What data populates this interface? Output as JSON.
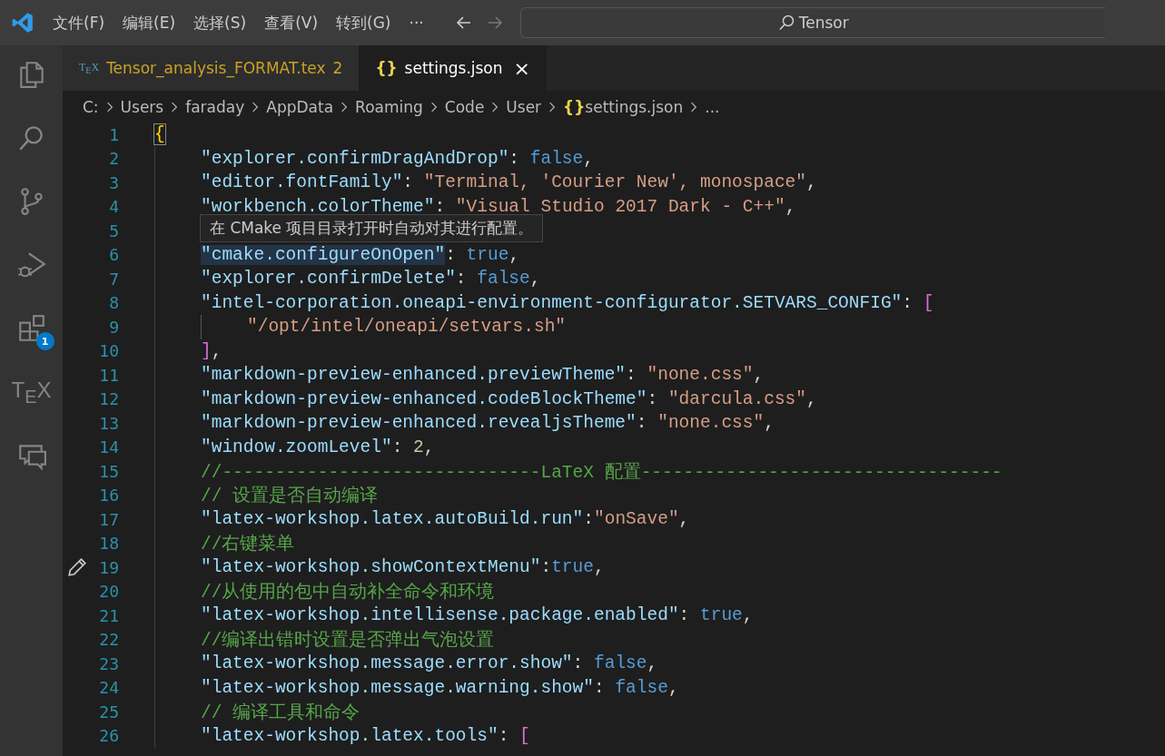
{
  "menu_bar": {
    "items": [
      "文件(F)",
      "编辑(E)",
      "选择(S)",
      "查看(V)",
      "转到(G)",
      "···"
    ],
    "search": {
      "value": "Tensor"
    }
  },
  "activity_bar": {
    "items": [
      {
        "kind": "files",
        "selected": false
      },
      {
        "kind": "search",
        "selected": false
      },
      {
        "kind": "source-control",
        "selected": false
      },
      {
        "kind": "run-debug",
        "selected": false
      },
      {
        "kind": "extensions",
        "selected": false,
        "badge": "1"
      },
      {
        "kind": "tex",
        "selected": false,
        "label": "T$_{E}$X"
      },
      {
        "kind": "remote",
        "selected": false
      }
    ]
  },
  "tabs": [
    {
      "icon": "T$_{E}$X",
      "kind": "tex",
      "label": "Tensor_analysis_FORMAT.tex",
      "problems": "2",
      "selected": false
    },
    {
      "icon": "{}",
      "kind": "json",
      "label": "settings.json",
      "selected": true,
      "close": "×"
    }
  ],
  "breadcrumb": [
    {
      "label": "C:"
    },
    {
      "label": "Users"
    },
    {
      "label": "faraday"
    },
    {
      "label": "AppData"
    },
    {
      "label": "Roaming"
    },
    {
      "label": "Code"
    },
    {
      "label": "User"
    },
    {
      "label": "settings.json",
      "icon": "{}"
    },
    {
      "label": "..."
    }
  ],
  "code": {
    "lines": [
      {
        "number": "1",
        "edit_marker": false,
        "tokens": [
          {
            "kind": "bracket_match",
            "text": "{"
          }
        ],
        "children": [
          {
            "number": "2",
            "edit_marker": false,
            "tokens": [
              {
                "kind": "key",
                "text": "\"explorer.confirmDragAndDrop\""
              },
              {
                "kind": "punct",
                "text": ": "
              },
              {
                "kind": "bool",
                "text": "false"
              },
              {
                "kind": "punct",
                "text": ","
              }
            ]
          },
          {
            "number": "3",
            "edit_marker": false,
            "tokens": [
              {
                "kind": "key",
                "text": "\"editor.fontFamily\""
              },
              {
                "kind": "punct",
                "text": ": "
              },
              {
                "kind": "str",
                "text": "\"Terminal, 'Courier New', monospace\""
              },
              {
                "kind": "punct",
                "text": ","
              }
            ]
          },
          {
            "number": "4",
            "edit_marker": false,
            "tokens": [
              {
                "kind": "key",
                "text": "\"workbench.colorTheme\""
              },
              {
                "kind": "punct",
                "text": ": "
              },
              {
                "kind": "str",
                "text": "\"Visual Studio 2017 Dark - C++\""
              },
              {
                "kind": "punct",
                "text": ","
              }
            ]
          },
          {
            "number": "5",
            "edit_marker": false
          },
          {
            "number": "6",
            "edit_marker": false,
            "tokens": [
              {
                "kind": "key",
                "text": "\"cmake.configureOnOpen\"",
                "highlighted": true
              },
              {
                "kind": "punct",
                "text": ": "
              },
              {
                "kind": "bool",
                "text": "true"
              },
              {
                "kind": "punct",
                "text": ","
              }
            ]
          },
          {
            "number": "7",
            "edit_marker": false,
            "tokens": [
              {
                "kind": "key",
                "text": "\"explorer.confirmDelete\""
              },
              {
                "kind": "punct",
                "text": ": "
              },
              {
                "kind": "bool",
                "text": "false"
              },
              {
                "kind": "punct",
                "text": ","
              }
            ]
          },
          {
            "number": "8",
            "edit_marker": false,
            "tokens": [
              {
                "kind": "key",
                "text": "\"intel-corporation.oneapi-environment-configurator.SETVARS_CONFIG\""
              },
              {
                "kind": "punct",
                "text": ": "
              },
              {
                "kind": "bracket",
                "text": "["
              }
            ],
            "children": [
              {
                "number": "9",
                "edit_marker": false,
                "tokens": [
                  {
                    "kind": "str",
                    "text": "\"/opt/intel/oneapi/setvars.sh\""
                  }
                ]
              }
            ]
          },
          {
            "number": "10",
            "edit_marker": false,
            "tokens": [
              {
                "kind": "bracket",
                "text": "]"
              },
              {
                "kind": "punct",
                "text": ","
              }
            ]
          },
          {
            "number": "11",
            "edit_marker": false,
            "tokens": [
              {
                "kind": "key",
                "text": "\"markdown-preview-enhanced.previewTheme\""
              },
              {
                "kind": "punct",
                "text": ": "
              },
              {
                "kind": "str",
                "text": "\"none.css\""
              },
              {
                "kind": "punct",
                "text": ","
              }
            ]
          },
          {
            "number": "12",
            "edit_marker": false,
            "tokens": [
              {
                "kind": "key",
                "text": "\"markdown-preview-enhanced.codeBlockTheme\""
              },
              {
                "kind": "punct",
                "text": ": "
              },
              {
                "kind": "str",
                "text": "\"darcula.css\""
              },
              {
                "kind": "punct",
                "text": ","
              }
            ]
          },
          {
            "number": "13",
            "edit_marker": false,
            "tokens": [
              {
                "kind": "key",
                "text": "\"markdown-preview-enhanced.revealjsTheme\""
              },
              {
                "kind": "punct",
                "text": ": "
              },
              {
                "kind": "str",
                "text": "\"none.css\""
              },
              {
                "kind": "punct",
                "text": ","
              }
            ]
          },
          {
            "number": "14",
            "edit_marker": false,
            "tokens": [
              {
                "kind": "key",
                "text": "\"window.zoomLevel\""
              },
              {
                "kind": "punct",
                "text": ": "
              },
              {
                "kind": "num",
                "text": "2"
              },
              {
                "kind": "punct",
                "text": ","
              }
            ]
          },
          {
            "number": "15",
            "edit_marker": false,
            "tokens": [
              {
                "kind": "comment",
                "text": "//------------------------------LaTeX 配置----------------------------------"
              }
            ]
          },
          {
            "number": "16",
            "edit_marker": false,
            "tokens": [
              {
                "kind": "comment",
                "text": "// 设置是否自动编译"
              }
            ]
          },
          {
            "number": "17",
            "edit_marker": false,
            "tokens": [
              {
                "kind": "key",
                "text": "\"latex-workshop.latex.autoBuild.run\""
              },
              {
                "kind": "punct",
                "text": ":"
              },
              {
                "kind": "str",
                "text": "\"onSave\""
              },
              {
                "kind": "punct",
                "text": ","
              }
            ]
          },
          {
            "number": "18",
            "edit_marker": false,
            "tokens": [
              {
                "kind": "comment",
                "text": "//右键菜单"
              }
            ]
          },
          {
            "number": "19",
            "edit_marker": true,
            "tokens": [
              {
                "kind": "key",
                "text": "\"latex-workshop.showContextMenu\""
              },
              {
                "kind": "punct",
                "text": ":"
              },
              {
                "kind": "bool",
                "text": "true"
              },
              {
                "kind": "punct",
                "text": ","
              }
            ]
          },
          {
            "number": "20",
            "edit_marker": false,
            "tokens": [
              {
                "kind": "comment",
                "text": "//从使用的包中自动补全命令和环境"
              }
            ]
          },
          {
            "number": "21",
            "edit_marker": false,
            "tokens": [
              {
                "kind": "key",
                "text": "\"latex-workshop.intellisense.package.enabled\""
              },
              {
                "kind": "punct",
                "text": ": "
              },
              {
                "kind": "bool",
                "text": "true"
              },
              {
                "kind": "punct",
                "text": ","
              }
            ]
          },
          {
            "number": "22",
            "edit_marker": false,
            "tokens": [
              {
                "kind": "comment",
                "text": "//编译出错时设置是否弹出气泡设置"
              }
            ]
          },
          {
            "number": "23",
            "edit_marker": false,
            "tokens": [
              {
                "kind": "key",
                "text": "\"latex-workshop.message.error.show\""
              },
              {
                "kind": "punct",
                "text": ": "
              },
              {
                "kind": "bool",
                "text": "false"
              },
              {
                "kind": "punct",
                "text": ","
              }
            ]
          },
          {
            "number": "24",
            "edit_marker": false,
            "tokens": [
              {
                "kind": "key",
                "text": "\"latex-workshop.message.warning.show\""
              },
              {
                "kind": "punct",
                "text": ": "
              },
              {
                "kind": "bool",
                "text": "false"
              },
              {
                "kind": "punct",
                "text": ","
              }
            ]
          },
          {
            "number": "25",
            "edit_marker": false,
            "tokens": [
              {
                "kind": "comment",
                "text": "// 编译工具和命令"
              }
            ]
          },
          {
            "number": "26",
            "edit_marker": false,
            "tokens": [
              {
                "kind": "key",
                "text": "\"latex-workshop.latex.tools\""
              },
              {
                "kind": "punct",
                "text": ": "
              },
              {
                "kind": "bracket",
                "text": "["
              }
            ]
          }
        ]
      }
    ]
  },
  "hover_tooltip": {
    "text": "在 CMake 项目目录打开时自动对其进行配置。"
  }
}
